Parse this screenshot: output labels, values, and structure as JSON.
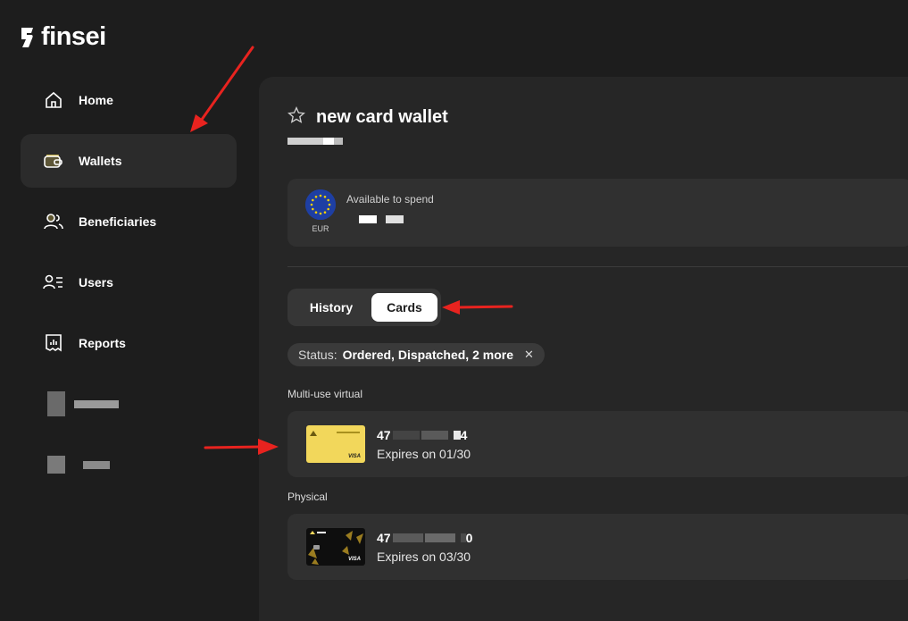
{
  "brand": {
    "name": "finsei"
  },
  "sidebar": {
    "items": [
      {
        "label": "Home",
        "icon": "home-icon"
      },
      {
        "label": "Wallets",
        "icon": "wallet-icon",
        "active": true
      },
      {
        "label": "Beneficiaries",
        "icon": "users-icon"
      },
      {
        "label": "Users",
        "icon": "user-list-icon"
      },
      {
        "label": "Reports",
        "icon": "report-icon"
      }
    ]
  },
  "wallet": {
    "title": "new card wallet",
    "currency": "EUR",
    "available_label": "Available to spend"
  },
  "tabs": {
    "history": "History",
    "cards": "Cards",
    "active": "Cards"
  },
  "filter": {
    "key": "Status:",
    "value": "Ordered, Dispatched, 2 more",
    "clear": "✕"
  },
  "sections": {
    "virtual": {
      "label": "Multi-use virtual",
      "card": {
        "number_prefix": "47",
        "number_suffix": "4",
        "expiry": "Expires on 01/30",
        "brand": "VISA"
      }
    },
    "physical": {
      "label": "Physical",
      "card": {
        "number_prefix": "47",
        "number_suffix": "0",
        "expiry": "Expires on 03/30",
        "brand": "VISA"
      }
    }
  },
  "colors": {
    "background": "#1d1d1d",
    "panel": "#262626",
    "surface": "#303030",
    "annotation_arrow": "#e8231f",
    "virtual_card": "#f2d75b",
    "physical_card": "#0e0e0e"
  }
}
